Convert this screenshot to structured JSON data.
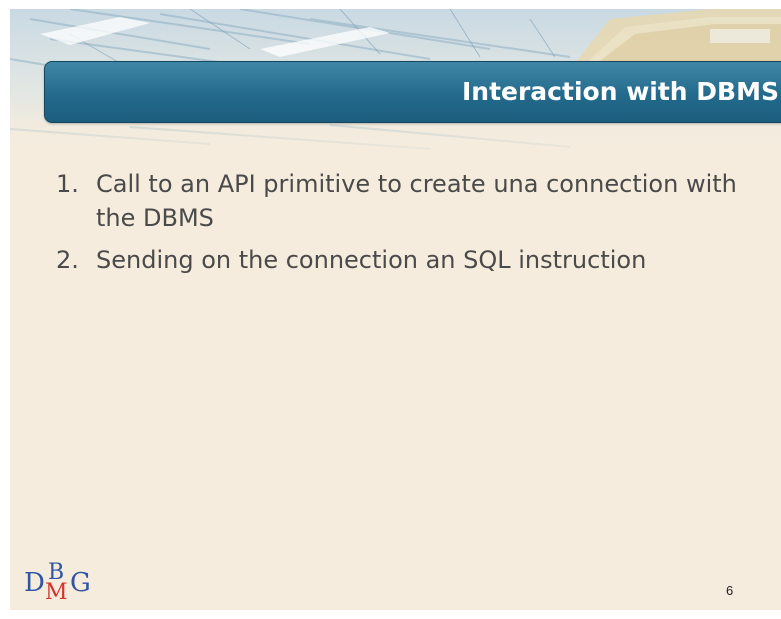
{
  "slide": {
    "title": "Interaction with DBMS",
    "items": [
      {
        "number": "1.",
        "text": "Call to an API primitive to create una connection with the DBMS"
      },
      {
        "number": "2.",
        "text": "Sending on the connection an SQL instruction"
      }
    ],
    "page_number": "6"
  },
  "logo": {
    "letter_d": "D",
    "letter_b": "B",
    "letter_m": "M",
    "letter_g": "G"
  },
  "colors": {
    "background": "#f6ecdd",
    "title_bar": "#236a8c",
    "title_text": "#ffffff",
    "body_text": "#4a4a4a",
    "logo_blue": "#2f55a4",
    "logo_red": "#d6332d"
  }
}
